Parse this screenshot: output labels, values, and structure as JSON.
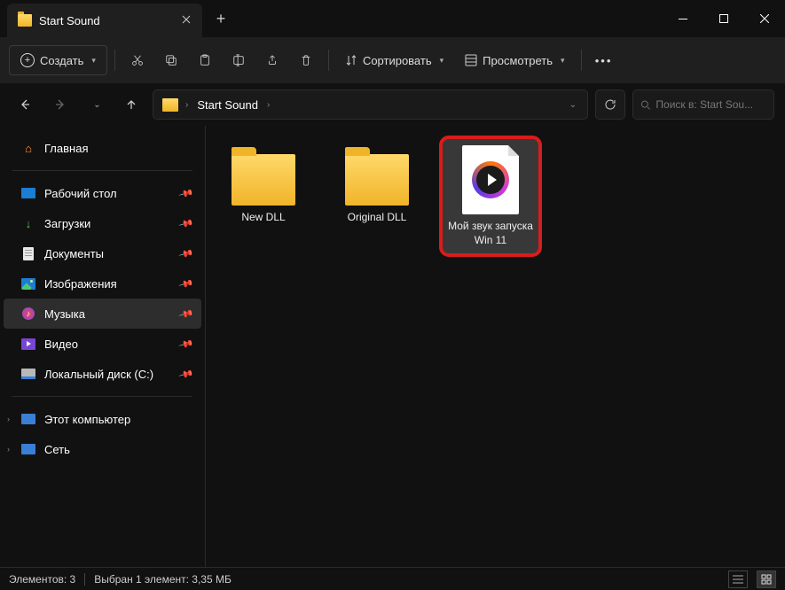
{
  "tab": {
    "title": "Start Sound"
  },
  "toolbar": {
    "create": "Создать",
    "sort": "Сортировать",
    "view": "Просмотреть"
  },
  "breadcrumb": {
    "item": "Start Sound"
  },
  "search": {
    "placeholder": "Поиск в: Start Sou..."
  },
  "sidebar": {
    "home": "Главная",
    "desktop": "Рабочий стол",
    "downloads": "Загрузки",
    "documents": "Документы",
    "pictures": "Изображения",
    "music": "Музыка",
    "video": "Видео",
    "disk": "Локальный диск (C:)",
    "pc": "Этот компьютер",
    "net": "Сеть"
  },
  "files": {
    "f1": "New DLL",
    "f2": "Original DLL",
    "f3": "Мой звук запуска Win 11"
  },
  "status": {
    "count": "Элементов: 3",
    "sel": "Выбран 1 элемент: 3,35 МБ"
  }
}
